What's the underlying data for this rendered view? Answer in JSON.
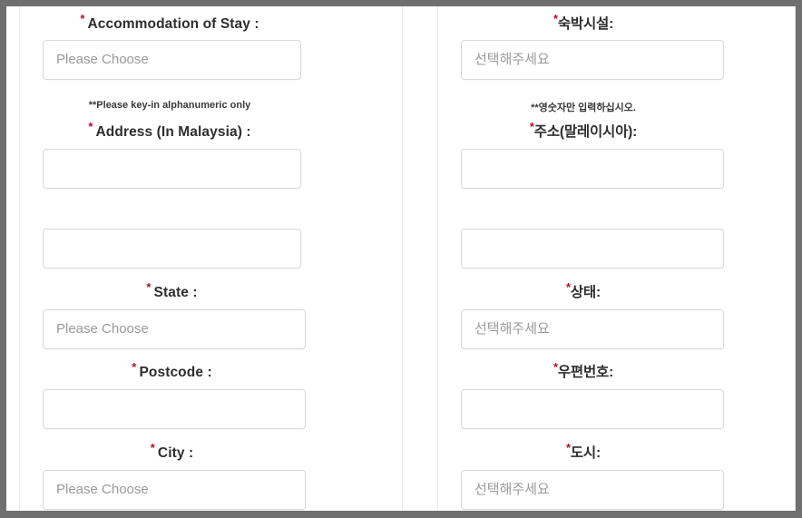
{
  "form": {
    "required_marker": "*",
    "double_marker": "**",
    "accent_color": "#b5102b",
    "columns": [
      {
        "id": "english",
        "language": "English",
        "fields": [
          {
            "name": "accommodation-of-stay",
            "label": "Accommodation of Stay :",
            "required": true,
            "control": "select",
            "value": "",
            "placeholder": "Please Choose"
          },
          {
            "name": "address-in-malaysia",
            "label": "Address (In Malaysia) :",
            "required": true,
            "helper": "**Please key-in alphanumeric only",
            "control": "text",
            "value": "",
            "placeholder": ""
          },
          {
            "name": "address-line-2",
            "label": "",
            "required": false,
            "control": "text",
            "value": "",
            "placeholder": ""
          },
          {
            "name": "state",
            "label": "State :",
            "required": true,
            "control": "select",
            "value": "",
            "placeholder": "Please Choose"
          },
          {
            "name": "postcode",
            "label": "Postcode :",
            "required": true,
            "control": "text",
            "value": "",
            "placeholder": ""
          },
          {
            "name": "city",
            "label": "City :",
            "required": true,
            "control": "select",
            "value": "",
            "placeholder": "Please Choose"
          }
        ]
      },
      {
        "id": "korean",
        "language": "Korean",
        "fields": [
          {
            "name": "accommodation-of-stay",
            "label": "숙박시설:",
            "required": true,
            "control": "select",
            "value": "",
            "placeholder": "선택해주세요"
          },
          {
            "name": "address-in-malaysia",
            "label": "주소(말레이시아):",
            "required": true,
            "helper": "**영숫자만 입력하십시오.",
            "control": "text",
            "value": "",
            "placeholder": ""
          },
          {
            "name": "address-line-2",
            "label": "",
            "required": false,
            "control": "text",
            "value": "",
            "placeholder": ""
          },
          {
            "name": "state",
            "label": "상태:",
            "required": true,
            "control": "select",
            "value": "",
            "placeholder": "선택해주세요"
          },
          {
            "name": "postcode",
            "label": "우편번호:",
            "required": true,
            "control": "text",
            "value": "",
            "placeholder": ""
          },
          {
            "name": "city",
            "label": "도시:",
            "required": true,
            "control": "select",
            "value": "",
            "placeholder": "선택해주세요"
          }
        ]
      }
    ]
  }
}
